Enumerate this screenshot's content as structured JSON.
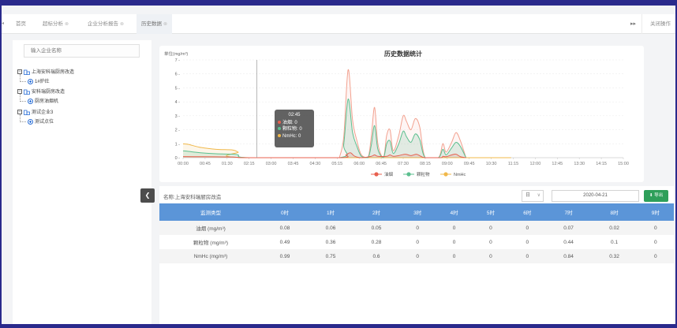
{
  "tabs": [
    {
      "label": "首页",
      "closable": false
    },
    {
      "label": "超标分析",
      "closable": true
    },
    {
      "label": "企业分析报告",
      "closable": true
    },
    {
      "label": "历史数据",
      "closable": true,
      "active": true
    }
  ],
  "tabbar": {
    "close_ops_label": "关闭操作",
    "forward_icon": "double-chevron-right-icon",
    "left_icon": "double-chevron-left-icon"
  },
  "sidebar": {
    "search_placeholder": "输入企业名称",
    "tree": [
      {
        "label": "上海安科瑞厨房改造",
        "type": "company",
        "expanded": true
      },
      {
        "label": "1#炉灶",
        "type": "point"
      },
      {
        "label": "安科瑞厨房改造",
        "type": "company",
        "expanded": true
      },
      {
        "label": "厨房油烟机",
        "type": "point"
      },
      {
        "label": "测试企业3",
        "type": "company",
        "expanded": true
      },
      {
        "label": "测试点位",
        "type": "point"
      }
    ]
  },
  "chart_data": {
    "type": "area",
    "title": "历史数据统计",
    "ylabel": "单位(mg/m³)",
    "xlabel": "",
    "ylim": [
      0,
      7
    ],
    "yticks": [
      0,
      1,
      2,
      3,
      4,
      5,
      6,
      7
    ],
    "x": [
      "00:00",
      "00:45",
      "01:30",
      "02:15",
      "03:00",
      "03:45",
      "04:30",
      "05:15",
      "06:00",
      "06:45",
      "07:30",
      "08:15",
      "09:00",
      "09:45",
      "10:30",
      "11:15",
      "12:00",
      "12:45",
      "13:30",
      "14:15",
      "15:00"
    ],
    "series": [
      {
        "name": "油烟",
        "color": "#e8604f",
        "points": [
          [
            0,
            0.08
          ],
          [
            0.75,
            0.07
          ],
          [
            1.5,
            0.06
          ],
          [
            2.25,
            0.05
          ],
          [
            2.5,
            0.02
          ],
          [
            3,
            0
          ],
          [
            7.1,
            0
          ],
          [
            7.4,
            0.2
          ],
          [
            7.6,
            0.35
          ],
          [
            7.8,
            0.1
          ],
          [
            8.1,
            0
          ],
          [
            8.55,
            0.1
          ],
          [
            8.7,
            0.2
          ],
          [
            8.85,
            0.1
          ],
          [
            9.25,
            0.1
          ],
          [
            9.4,
            0.2
          ],
          [
            9.55,
            0.1
          ],
          [
            9.8,
            0.15
          ],
          [
            10.1,
            0.25
          ],
          [
            10.35,
            0.15
          ],
          [
            10.6,
            0.25
          ],
          [
            10.8,
            0.1
          ],
          [
            11,
            0
          ],
          [
            11.7,
            0
          ],
          [
            11.8,
            0.1
          ],
          [
            11.95,
            0.07
          ],
          [
            12.2,
            0.2
          ],
          [
            12.4,
            0.25
          ],
          [
            12.6,
            0.07
          ],
          [
            12.85,
            0
          ]
        ]
      },
      {
        "name": "颗粒物",
        "color": "#5cbf8f",
        "points": [
          [
            0,
            0.49
          ],
          [
            0.25,
            0.45
          ],
          [
            0.75,
            0.36
          ],
          [
            1.5,
            0.28
          ],
          [
            2.25,
            0.25
          ],
          [
            2.5,
            0.2
          ],
          [
            3,
            0
          ],
          [
            7.1,
            0
          ],
          [
            7.3,
            1.0
          ],
          [
            7.5,
            4.2
          ],
          [
            7.7,
            1.8
          ],
          [
            7.9,
            0.8
          ],
          [
            8.1,
            0.1
          ],
          [
            8.4,
            0
          ],
          [
            8.55,
            0.9
          ],
          [
            8.7,
            2.3
          ],
          [
            8.85,
            0.6
          ],
          [
            9.1,
            0
          ],
          [
            9.25,
            1.0
          ],
          [
            9.4,
            1.2
          ],
          [
            9.55,
            0.3
          ],
          [
            9.8,
            1.0
          ],
          [
            10.0,
            1.9
          ],
          [
            10.15,
            1.5
          ],
          [
            10.35,
            1.1
          ],
          [
            10.55,
            1.7
          ],
          [
            10.75,
            1.3
          ],
          [
            11,
            0
          ],
          [
            11.6,
            0
          ],
          [
            11.8,
            0.6
          ],
          [
            11.95,
            0.2
          ],
          [
            12.2,
            0.7
          ],
          [
            12.4,
            1.1
          ],
          [
            12.6,
            0.8
          ],
          [
            12.85,
            0
          ]
        ]
      },
      {
        "name": "NmHc",
        "color": "#f0b84a",
        "points": [
          [
            0,
            0.99
          ],
          [
            0.25,
            0.95
          ],
          [
            0.75,
            0.75
          ],
          [
            1.5,
            0.6
          ],
          [
            2.25,
            0.55
          ],
          [
            2.5,
            0.4
          ],
          [
            3,
            0
          ],
          [
            14.9,
            0
          ]
        ]
      }
    ],
    "extra_outline": {
      "name": "油烟-峰值",
      "color": "#f2a18f",
      "points": [
        [
          7.1,
          0
        ],
        [
          7.3,
          1.5
        ],
        [
          7.5,
          6.3
        ],
        [
          7.7,
          2.7
        ],
        [
          7.9,
          1.2
        ],
        [
          8.1,
          0.2
        ],
        [
          8.4,
          0
        ],
        [
          8.55,
          1.5
        ],
        [
          8.7,
          3.6
        ],
        [
          8.85,
          1.0
        ],
        [
          9.1,
          0
        ],
        [
          9.25,
          1.6
        ],
        [
          9.4,
          2.0
        ],
        [
          9.55,
          0.5
        ],
        [
          9.8,
          1.6
        ],
        [
          10.0,
          3.0
        ],
        [
          10.15,
          2.6
        ],
        [
          10.35,
          2.0
        ],
        [
          10.55,
          2.8
        ],
        [
          10.75,
          2.2
        ],
        [
          11,
          0
        ],
        [
          11.6,
          0
        ],
        [
          11.8,
          1.0
        ],
        [
          11.95,
          0.4
        ],
        [
          12.2,
          1.1
        ],
        [
          12.4,
          1.8
        ],
        [
          12.6,
          1.2
        ],
        [
          12.85,
          0
        ]
      ]
    },
    "crosshair_index": 3.35,
    "tooltip": {
      "time": "02:45",
      "rows": [
        {
          "name": "油烟",
          "value": "0"
        },
        {
          "name": "颗粒物",
          "value": "0"
        },
        {
          "name": "NmHc",
          "value": "0"
        }
      ]
    },
    "legend": [
      "油烟",
      "颗粒物",
      "NmHc"
    ],
    "legend_position": "bottom-center",
    "grid": true
  },
  "table": {
    "title": "名称:上海安科瑞厨房改造",
    "period_select": "日",
    "date": "2020-04-21",
    "export_label": "导出",
    "headers": [
      "监测类型",
      "0时",
      "1时",
      "2时",
      "3时",
      "4时",
      "5时",
      "6时",
      "7时",
      "8时",
      "9时"
    ],
    "rows": [
      [
        "油烟 (mg/m³)",
        "0.08",
        "0.06",
        "0.05",
        "0",
        "0",
        "0",
        "0",
        "0.07",
        "0.02",
        "0"
      ],
      [
        "颗粒物 (mg/m³)",
        "0.49",
        "0.36",
        "0.28",
        "0",
        "0",
        "0",
        "0",
        "0.44",
        "0.1",
        "0"
      ],
      [
        "NmHc (mg/m³)",
        "0.99",
        "0.75",
        "0.6",
        "0",
        "0",
        "0",
        "0",
        "0.84",
        "0.32",
        "0"
      ]
    ]
  },
  "colors": {
    "accent": "#5b95d8",
    "export": "#2e9f5a",
    "frame": "#2a2a8c"
  }
}
